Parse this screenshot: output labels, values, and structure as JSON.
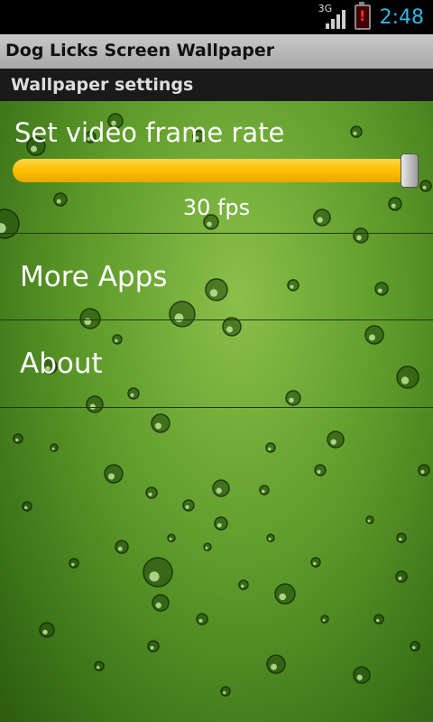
{
  "status_bar": {
    "network": "3G",
    "time": "2:48",
    "icons": [
      "signal-icon",
      "battery-alert-icon"
    ],
    "clock_color": "#33b5e5"
  },
  "app": {
    "title": "Dog Licks Screen Wallpaper"
  },
  "settings": {
    "header": "Wallpaper settings",
    "frame_rate": {
      "label": "Set video frame rate",
      "value_text": "30 fps",
      "value": 30,
      "fraction": 1.0
    },
    "items": [
      {
        "label": "More Apps"
      },
      {
        "label": "About"
      }
    ]
  },
  "colors": {
    "slider": "#ffbf00",
    "background": "#5e9b2a"
  }
}
